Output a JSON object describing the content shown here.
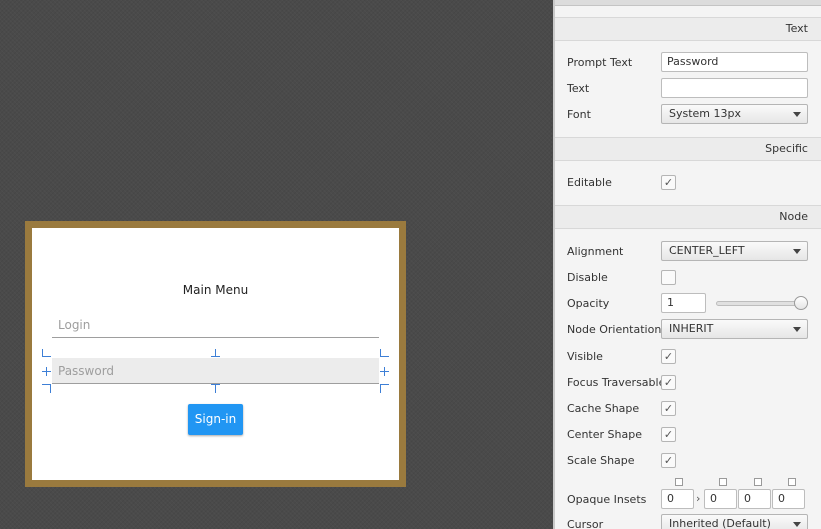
{
  "preview": {
    "title": "Main Menu",
    "login_placeholder": "Login",
    "password_placeholder": "Password",
    "signin_label": "Sign-in"
  },
  "inspector": {
    "sections": {
      "text": "Text",
      "specific": "Specific",
      "node": "Node"
    },
    "text": {
      "prompt_text_label": "Prompt Text",
      "prompt_text_value": "Password",
      "text_label": "Text",
      "text_value": "",
      "font_label": "Font",
      "font_value": "System 13px"
    },
    "specific": {
      "editable_label": "Editable",
      "editable_checked": true
    },
    "node": {
      "alignment_label": "Alignment",
      "alignment_value": "CENTER_LEFT",
      "disable_label": "Disable",
      "disable_checked": false,
      "opacity_label": "Opacity",
      "opacity_value": "1",
      "opacity_slider_fraction": 1.0,
      "node_orientation_label": "Node Orientation",
      "node_orientation_value": "INHERIT",
      "visible_label": "Visible",
      "visible_checked": true,
      "focus_traversable_label": "Focus Traversable",
      "focus_traversable_checked": true,
      "cache_shape_label": "Cache Shape",
      "cache_shape_checked": true,
      "center_shape_label": "Center Shape",
      "center_shape_checked": true,
      "scale_shape_label": "Scale Shape",
      "scale_shape_checked": true,
      "opaque_insets_label": "Opaque Insets",
      "opaque_insets_values": [
        "0",
        "0",
        "0",
        "0"
      ],
      "cursor_label": "Cursor",
      "cursor_value": "Inherited (Default)"
    },
    "checkmark_glyph": "✓"
  },
  "colors": {
    "stage_frame": "#9a7a3e",
    "signin_button": "#2196f3",
    "selection_handles": "#3d7fd6",
    "workspace_bg": "#4a4a4a"
  }
}
